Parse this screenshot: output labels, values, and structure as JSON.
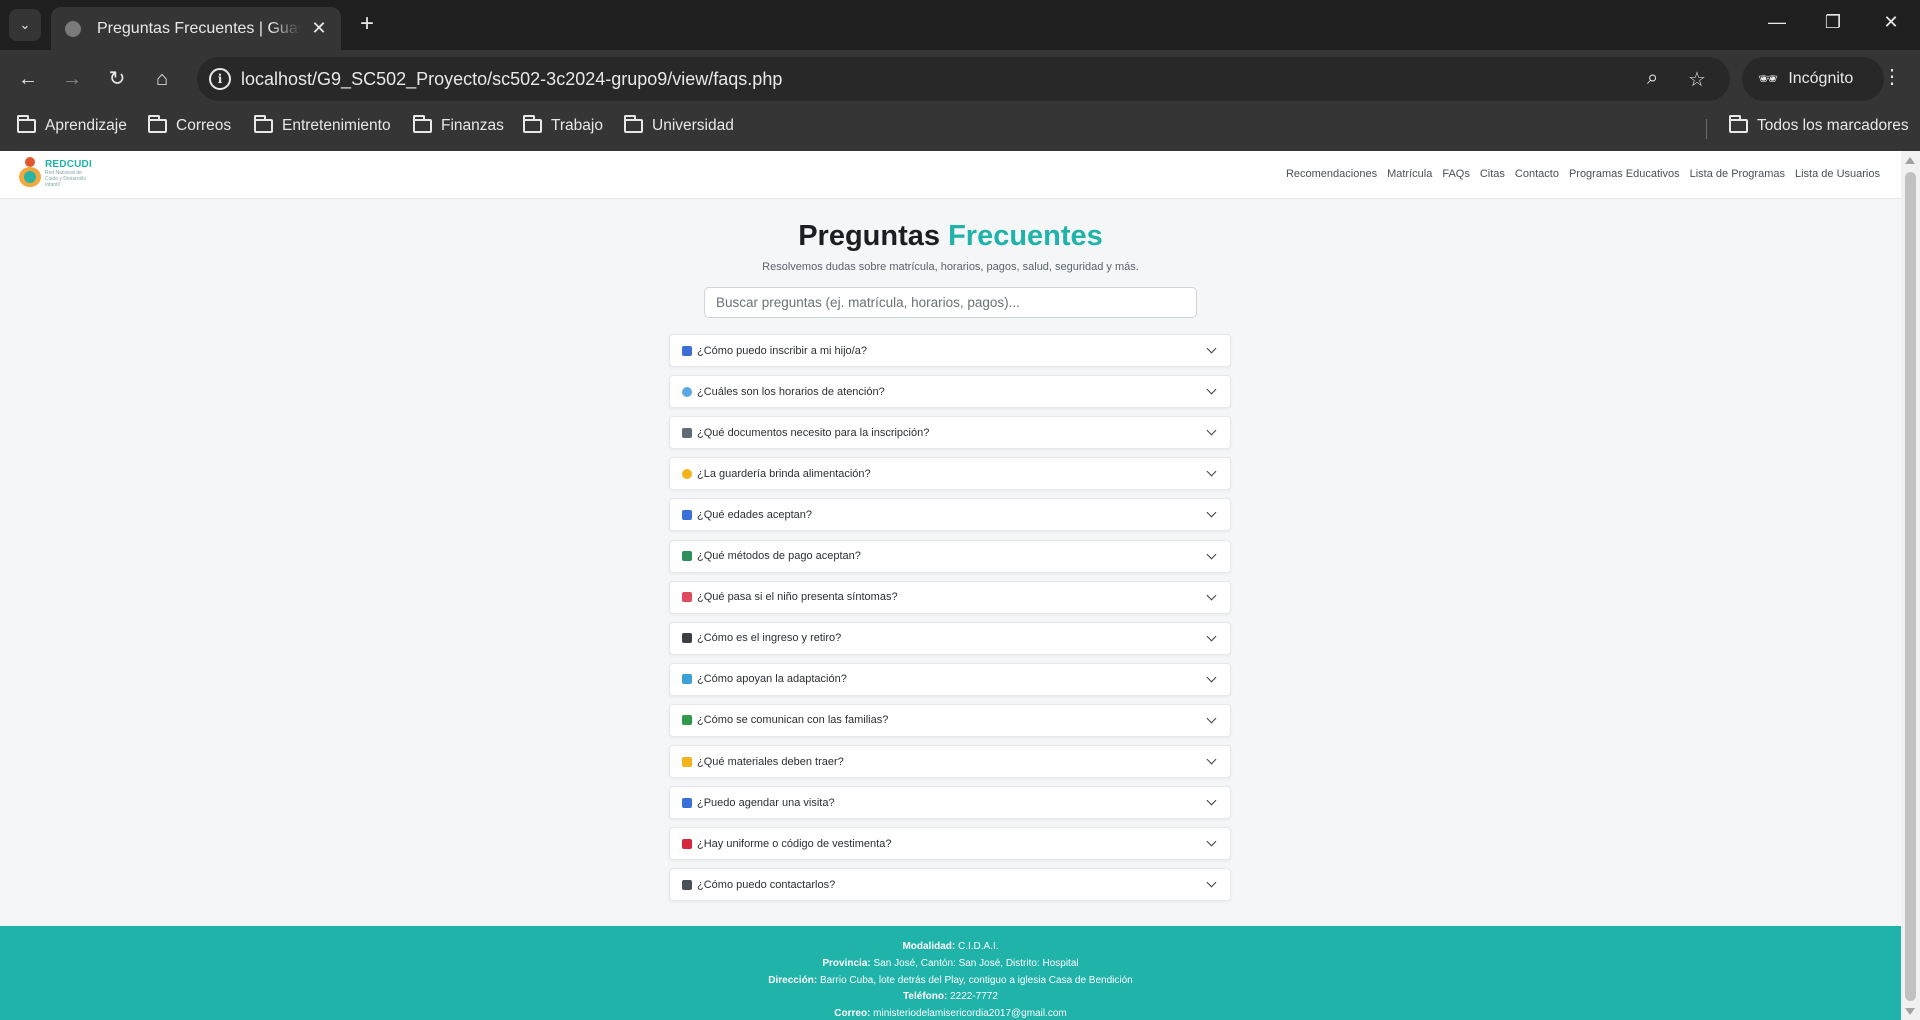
{
  "browser": {
    "tab_title": "Preguntas Frecuentes | Guardería",
    "tab_close": "✕",
    "new_tab": "+",
    "url_host": "localhost",
    "url_path": "/G9_SC502_Proyecto/sc502-3c2024-grupo9/view/faqs.php",
    "profile_label": "Incógnito",
    "bookmarks": [
      "Aprendizaje",
      "Correos",
      "Entretenimiento",
      "Finanzas",
      "Trabajo",
      "Universidad"
    ],
    "all_bookmarks": "Todos los marcadores"
  },
  "site": {
    "logo_name": "REDCUDI",
    "logo_sub": "Red Nacional de Cuido y Desarrollo Infantil",
    "nav": [
      "Recomendaciones",
      "Matrícula",
      "FAQs",
      "Citas",
      "Contacto",
      "Programas Educativos",
      "Lista de Programas",
      "Lista de Usuarios"
    ]
  },
  "hero": {
    "title_main": "Preguntas",
    "title_accent": "Frecuentes",
    "subtitle": "Resolvemos dudas sobre matrícula, horarios, pagos, salud, seguridad y más.",
    "search_placeholder": "Buscar preguntas (ej. matrícula, horarios, pagos)..."
  },
  "faqs": [
    {
      "icon": "child-icon",
      "color": "#3b6fd8",
      "question": "¿Cómo puedo inscribir a mi hijo/a?"
    },
    {
      "icon": "clock-icon",
      "color": "#5aa9e6",
      "question": "¿Cuáles son los horarios de atención?"
    },
    {
      "icon": "folder-open-icon",
      "color": "#5f6b76",
      "question": "¿Qué documentos necesito para la inscripción?"
    },
    {
      "icon": "meal-icon",
      "color": "#f2b31b",
      "question": "¿La guardería brinda alimentación?"
    },
    {
      "icon": "child-raised-arms-icon",
      "color": "#3b6fd8",
      "question": "¿Qué edades aceptan?"
    },
    {
      "icon": "money-hand-icon",
      "color": "#2f8f5b",
      "question": "¿Qué métodos de pago aceptan?"
    },
    {
      "icon": "medical-kit-icon",
      "color": "#e04a5f",
      "question": "¿Qué pasa si el niño presenta síntomas?"
    },
    {
      "icon": "sign-in-icon",
      "color": "#3a3f45",
      "question": "¿Cómo es el ingreso y retiro?"
    },
    {
      "icon": "helping-hands-icon",
      "color": "#3aa0d8",
      "question": "¿Cómo apoyan la adaptación?"
    },
    {
      "icon": "chat-bubbles-icon",
      "color": "#2f9a4a",
      "question": "¿Cómo se comunican con las familias?"
    },
    {
      "icon": "backpack-icon",
      "color": "#f2b31b",
      "question": "¿Qué materiales deben traer?"
    },
    {
      "icon": "calendar-icon",
      "color": "#3b6fd8",
      "question": "¿Puedo agendar una visita?"
    },
    {
      "icon": "shirt-icon",
      "color": "#d8263c",
      "question": "¿Hay uniforme o código de vestimenta?"
    },
    {
      "icon": "envelope-icon",
      "color": "#4a5057",
      "question": "¿Cómo puedo contactarlos?"
    }
  ],
  "footer": [
    {
      "label": "Modalidad:",
      "value": "C.I.D.A.I."
    },
    {
      "label": "Provincia:",
      "value": "San José, Cantón: San José, Distrito: Hospital"
    },
    {
      "label": "Dirección:",
      "value": "Barrio Cuba, lote detrás del Play, contiguo a iglesia Casa de Bendición"
    },
    {
      "label": "Teléfono:",
      "value": "2222-7772"
    },
    {
      "label": "Correo:",
      "value": "ministeriodelamisericordia2017@gmail.com"
    }
  ]
}
